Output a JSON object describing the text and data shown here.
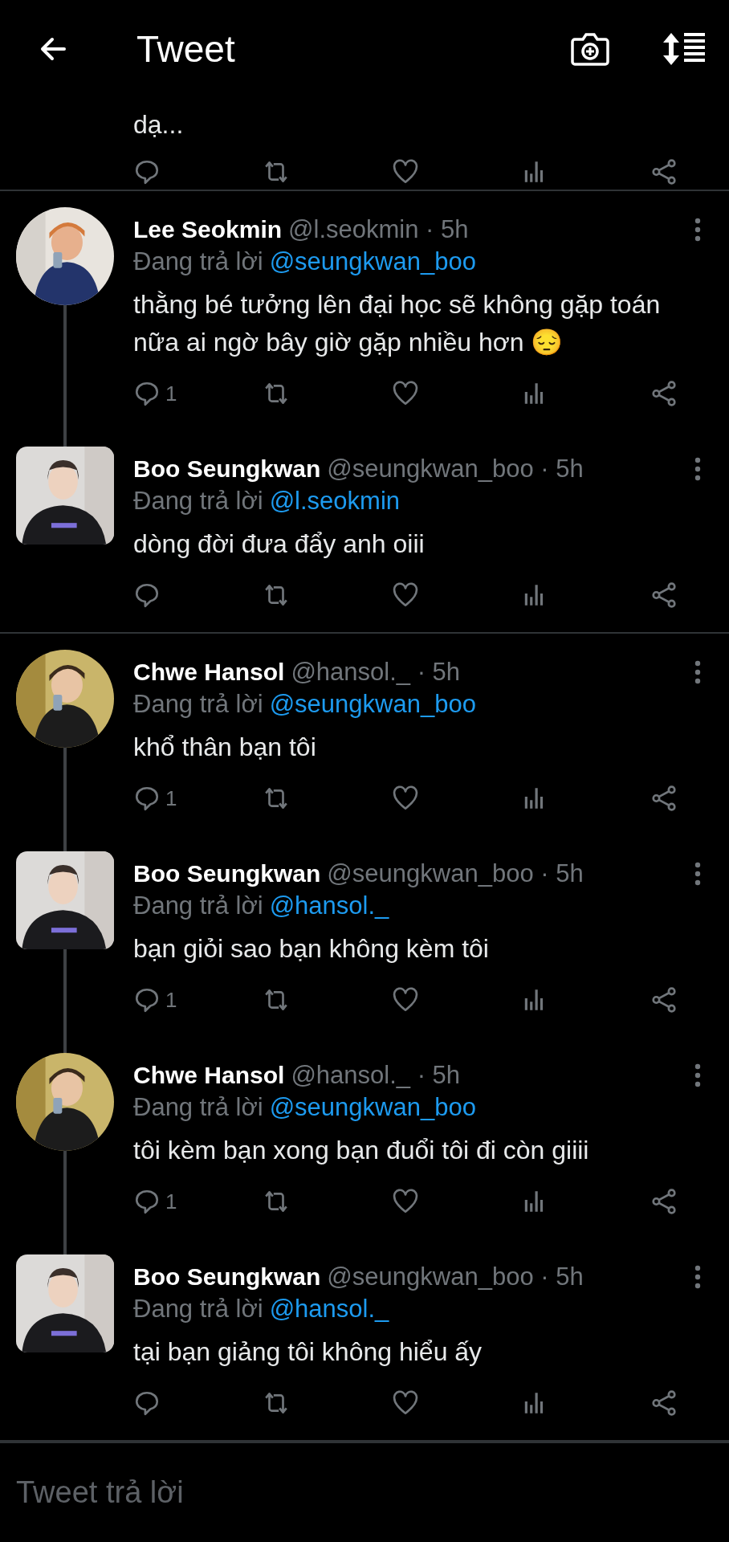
{
  "top_bar": {
    "title": "Tweet"
  },
  "previous_tweet": {
    "text": "dạ..."
  },
  "threads": [
    {
      "tweets": [
        {
          "name": "Lee Seokmin",
          "meta": "@l.seokmin · 5h",
          "reply_prefix": "Đang trả lời",
          "reply_to": "@seungkwan_boo",
          "text": "thằng bé tưởng lên đại học sẽ không gặp toán nữa ai ngờ bây giờ gặp nhiều hơn 😔",
          "reply_count": "1",
          "avatar": {
            "kind": "round"
          }
        },
        {
          "name": "Boo Seungkwan",
          "meta": "@seungkwan_boo · 5h",
          "reply_prefix": "Đang trả lời",
          "reply_to": "@l.seokmin",
          "text": "dòng đời đưa đẩy anh oiii",
          "avatar": {
            "kind": "square"
          }
        }
      ]
    },
    {
      "tweets": [
        {
          "name": "Chwe Hansol",
          "meta": "@hansol._ · 5h",
          "reply_prefix": "Đang trả lời",
          "reply_to": "@seungkwan_boo",
          "text": "khổ thân bạn tôi",
          "reply_count": "1",
          "avatar": {
            "kind": "round"
          }
        },
        {
          "name": "Boo Seungkwan",
          "meta": "@seungkwan_boo · 5h",
          "reply_prefix": "Đang trả lời",
          "reply_to": "@hansol._",
          "text": "bạn giỏi sao bạn không kèm tôi",
          "reply_count": "1",
          "avatar": {
            "kind": "square"
          }
        },
        {
          "name": "Chwe Hansol",
          "meta": "@hansol._ · 5h",
          "reply_prefix": "Đang trả lời",
          "reply_to": "@seungkwan_boo",
          "text": "tôi kèm bạn xong bạn đuổi tôi đi còn giiii",
          "reply_count": "1",
          "avatar": {
            "kind": "round"
          }
        },
        {
          "name": "Boo Seungkwan",
          "meta": "@seungkwan_boo · 5h",
          "reply_prefix": "Đang trả lời",
          "reply_to": "@hansol._",
          "text": "tại bạn giảng tôi không hiểu ấy",
          "avatar": {
            "kind": "square"
          }
        }
      ]
    }
  ],
  "reply_bar": {
    "placeholder": "Tweet trả lời"
  }
}
